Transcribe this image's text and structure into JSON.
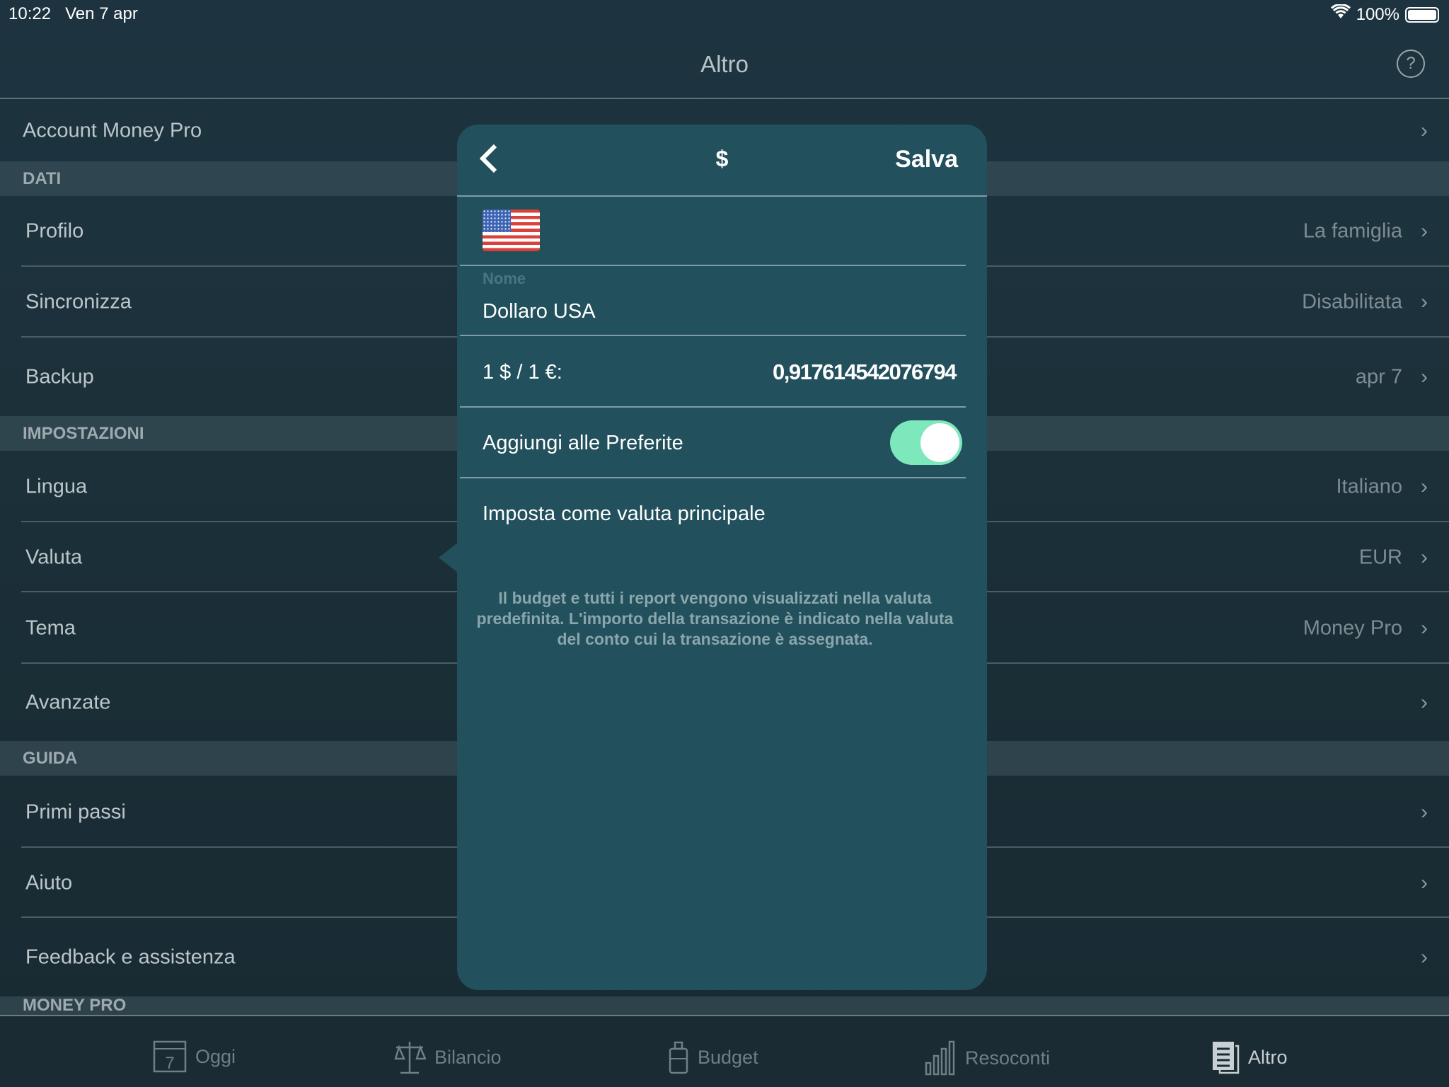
{
  "status": {
    "time": "10:22",
    "date": "Ven 7 apr",
    "battery": "100%",
    "battery_level": 1.0
  },
  "nav": {
    "title": "Altro",
    "help": "?"
  },
  "account": {
    "label": "Account Money Pro"
  },
  "sections": [
    {
      "header": "DATI",
      "rows": [
        {
          "label": "Profilo",
          "value": "La famiglia"
        },
        {
          "label": "Sincronizza",
          "value": "Disabilitata"
        },
        {
          "label": "Backup",
          "value": "apr 7"
        }
      ]
    },
    {
      "header": "IMPOSTAZIONI",
      "rows": [
        {
          "label": "Lingua",
          "value": "Italiano"
        },
        {
          "label": "Valuta",
          "value": "EUR"
        },
        {
          "label": "Tema",
          "value": "Money Pro"
        },
        {
          "label": "Avanzate",
          "value": ""
        }
      ]
    },
    {
      "header": "GUIDA",
      "rows": [
        {
          "label": "Primi passi",
          "value": ""
        },
        {
          "label": "Aiuto",
          "value": ""
        },
        {
          "label": "Feedback e assistenza",
          "value": ""
        }
      ]
    },
    {
      "header": "MONEY PRO",
      "rows": []
    }
  ],
  "popup": {
    "title": "$",
    "save": "Salva",
    "name_label": "Nome",
    "name_value": "Dollaro USA",
    "rate_label": "1 $ / 1 €:",
    "rate_value": "0,917614542076794",
    "favorite_label": "Aggiungi alle Preferite",
    "favorite_on": true,
    "set_main": "Imposta come valuta principale",
    "note": "Il budget e tutti i report vengono visualizzati nella valuta predefinita. L'importo della transazione è indicato nella valuta del conto cui la transazione è assegnata.",
    "toggle_color": "#7ee8bd"
  },
  "tabs": [
    {
      "label": "Oggi",
      "icon": "calendar-icon",
      "day": "7"
    },
    {
      "label": "Bilancio",
      "icon": "scale-icon"
    },
    {
      "label": "Budget",
      "icon": "jar-icon"
    },
    {
      "label": "Resoconti",
      "icon": "bar-chart-icon"
    },
    {
      "label": "Altro",
      "icon": "document-icon",
      "active": true
    }
  ]
}
